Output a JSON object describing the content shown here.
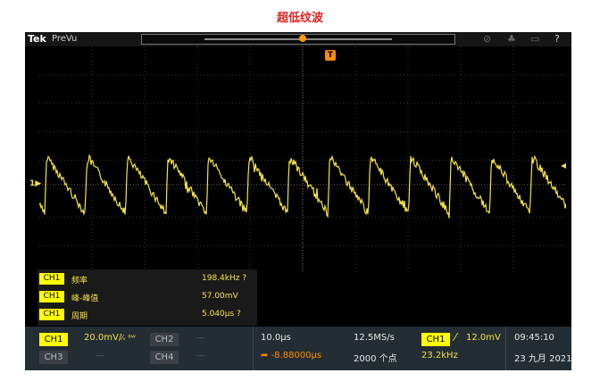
{
  "page_title": "超低纹波",
  "topbar": {
    "brand": "Tek",
    "mode": "PreVu",
    "help_icon": "?"
  },
  "trigger_marker": "T",
  "ch1_marker": "1",
  "colors": {
    "trace": "#f4e34a",
    "trigger": "#ff8c00",
    "ch1": "#ffff00",
    "title": "#e02020"
  },
  "measurements": [
    {
      "channel": "CH1",
      "name": "频率",
      "value": "198.4kHz ?"
    },
    {
      "channel": "CH1",
      "name": "峰-峰值",
      "value": "57.00mV"
    },
    {
      "channel": "CH1",
      "name": "周期",
      "value": "5.040μs ?"
    }
  ],
  "status": {
    "ch1": {
      "label": "CH1",
      "scale": "20.0mV/",
      "suffix": "⁄ᵥ ᴮᵂ"
    },
    "ch2": {
      "label": "CH2",
      "value": "---"
    },
    "ch3": {
      "label": "CH3",
      "value": "---"
    },
    "ch4": {
      "label": "CH4",
      "value": "---"
    },
    "timebase": "10.0μs",
    "position": "-8.88000μs",
    "sample_rate": "12.5MS/s",
    "record_length": "2000 个点",
    "trigger_source": "CH1",
    "trigger_level": "12.0mV",
    "trigger_freq": "23.2kHz",
    "time": "09:45:10",
    "date": "23 九月 2021"
  }
}
